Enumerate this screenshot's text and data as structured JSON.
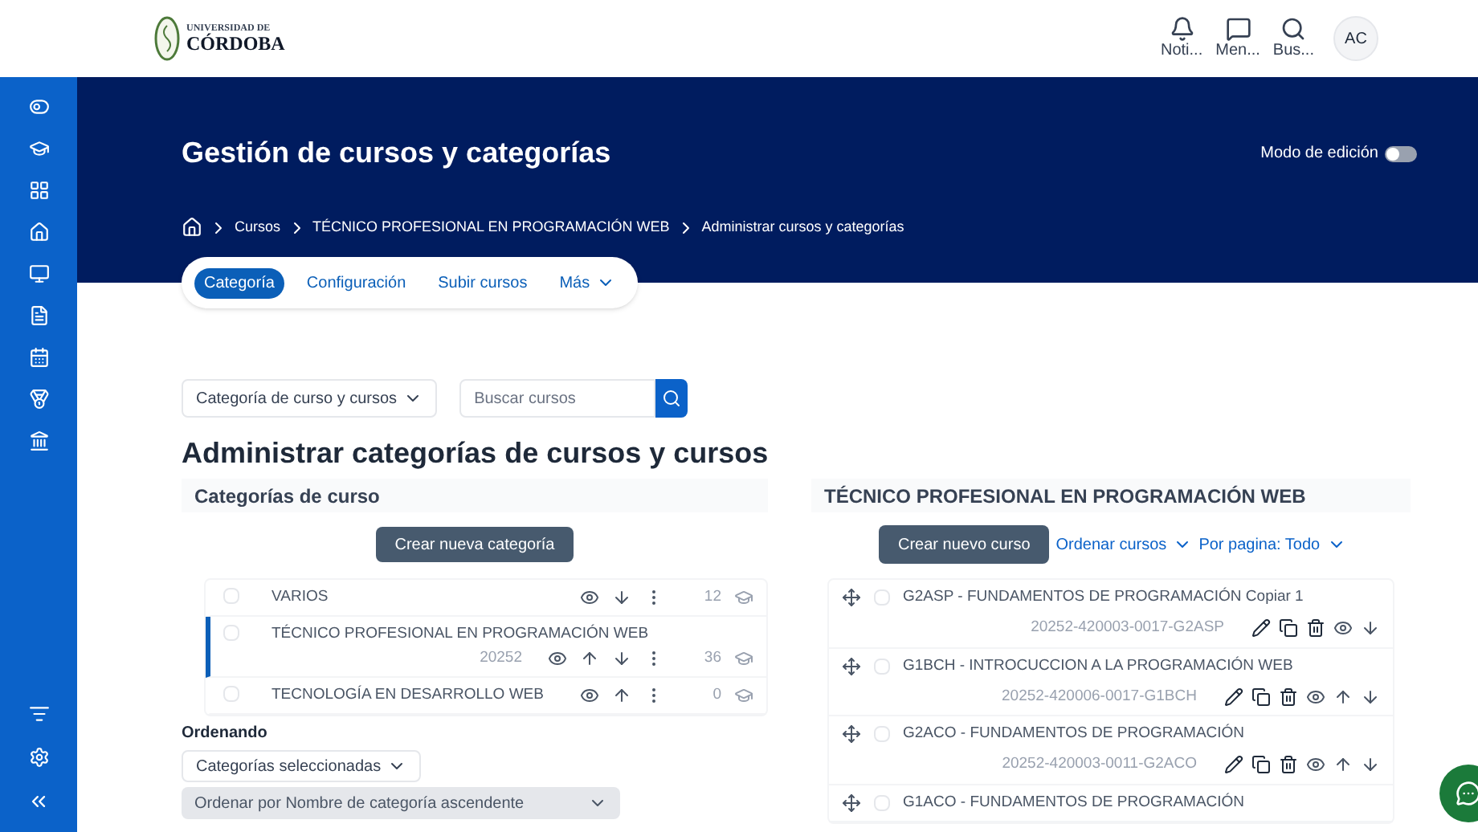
{
  "logo": {
    "line1": "UNIVERSIDAD DE",
    "line2": "CÓRDOBA"
  },
  "top_actions": [
    {
      "kind": "bell",
      "label": "Noti..."
    },
    {
      "kind": "chat",
      "label": "Men..."
    },
    {
      "kind": "search",
      "label": "Bus..."
    }
  ],
  "avatar": "AC",
  "header": {
    "title": "Gestión de cursos y categorías",
    "edit_mode": {
      "label": "Modo de edición",
      "on": false
    }
  },
  "breadcrumb": [
    "Cursos",
    "TÉCNICO PROFESIONAL EN PROGRAMACIÓN WEB",
    "Administrar cursos y categorías"
  ],
  "tabs": [
    {
      "label": "Categoría",
      "selected": true,
      "kind": "link"
    },
    {
      "label": "Configuración",
      "selected": false,
      "kind": "link"
    },
    {
      "label": "Subir cursos",
      "selected": false,
      "kind": "link"
    },
    {
      "label": "Más",
      "selected": false,
      "kind": "menu"
    }
  ],
  "view_select": "Categoría de curso y cursos",
  "search": {
    "placeholder": "Buscar cursos"
  },
  "heading": "Administrar categorías de cursos y cursos",
  "categories": {
    "title": "Categorías de curso",
    "button": "Crear nueva categoría",
    "items": [
      {
        "name": "VARIOS",
        "checked": false,
        "count": "12",
        "move_up": false,
        "move_down": true,
        "selected": false
      },
      {
        "name": "TÉCNICO PROFESIONAL EN PROGRAMACIÓN WEB",
        "code": "20252",
        "checked": false,
        "count": "36",
        "move_up": true,
        "move_down": true,
        "selected": true
      },
      {
        "name": "TECNOLOGÍA EN DESARROLLO WEB",
        "checked": false,
        "count": "0",
        "move_up": true,
        "move_down": false,
        "selected": false
      }
    ],
    "sorting": {
      "label": "Ordenando",
      "select": "Categorías seleccionadas",
      "order": "Ordenar por Nombre de categoría ascendente"
    }
  },
  "courses": {
    "title": "TÉCNICO PROFESIONAL EN PROGRAMACIÓN WEB",
    "button": "Crear nuevo curso",
    "sort_link": "Ordenar cursos",
    "per_page": "Por pagina: Todo",
    "items": [
      {
        "name": "G2ASP - FUNDAMENTOS DE PROGRAMACIÓN Copiar 1",
        "checked": false,
        "code": "20252-420003-0017-G2ASP",
        "move_up": false,
        "move_down": true
      },
      {
        "name": "G1BCH - INTROCUCCION A LA PROGRAMACIÓN WEB",
        "checked": false,
        "code": "20252-420006-0017-G1BCH",
        "move_up": true,
        "move_down": true
      },
      {
        "name": "G2ACO - FUNDAMENTOS DE PROGRAMACIÓN",
        "checked": false,
        "code": "20252-420003-0011-G2ACO",
        "move_up": true,
        "move_down": true
      },
      {
        "name": "G1ACO - FUNDAMENTOS DE PROGRAMACIÓN",
        "checked": false
      }
    ]
  }
}
